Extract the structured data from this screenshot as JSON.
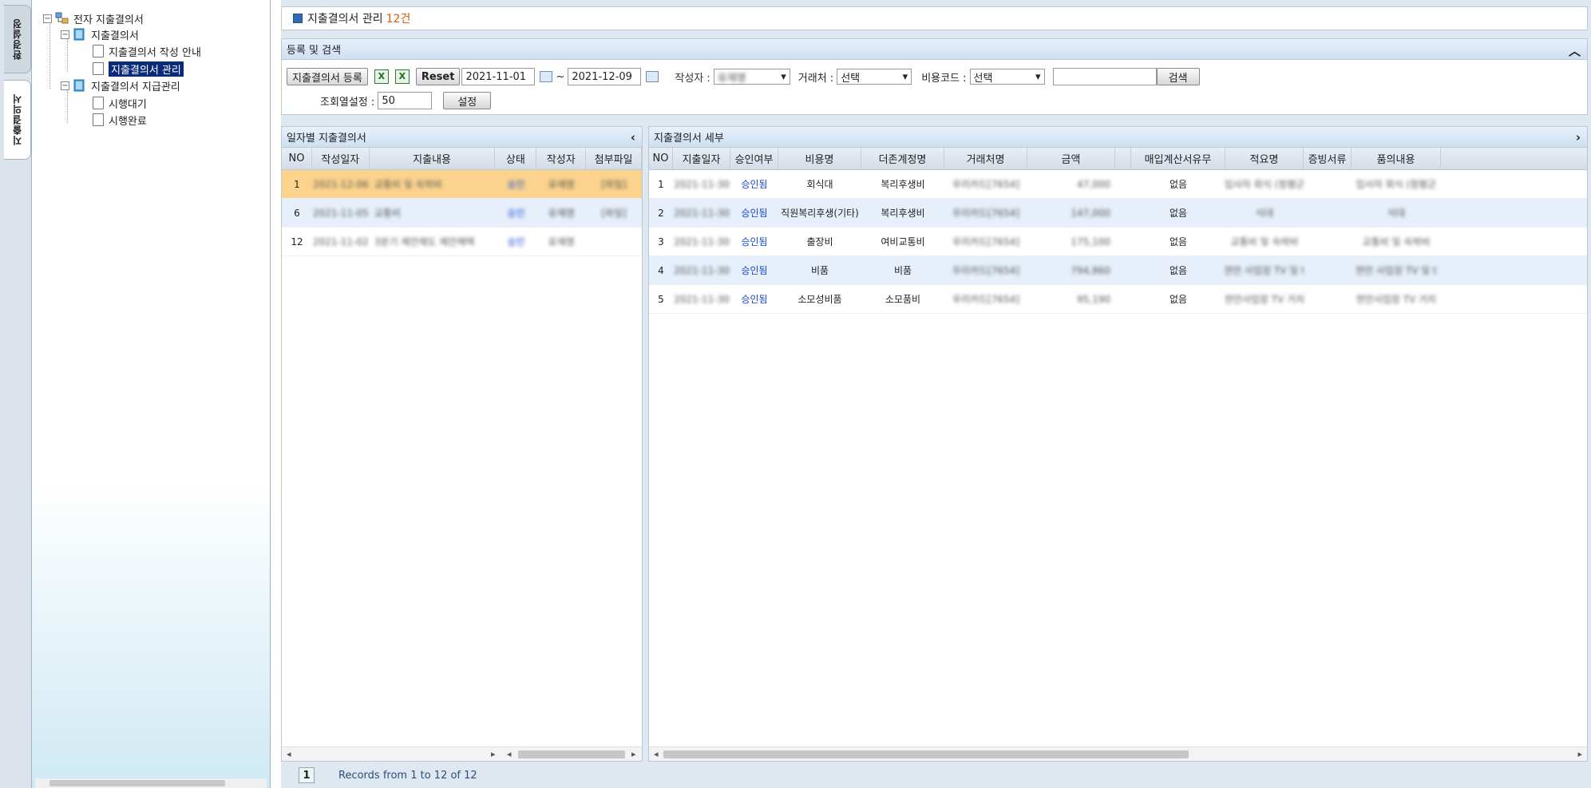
{
  "vtabs": [
    "환경설정",
    "지출결의서"
  ],
  "tree": {
    "root": "전자 지출결의서",
    "group1": "지출결의서",
    "group1_items": [
      "지출결의서 작성 안내",
      "지출결의서 관리"
    ],
    "group2": "지출결의서 지급관리",
    "group2_items": [
      "시행대기",
      "시행완료"
    ]
  },
  "title": {
    "label": "지출결의서 관리",
    "count": "12건"
  },
  "search": {
    "header": "등록 및 검색",
    "register_button": "지출결의서 등록",
    "reset_button": "Reset",
    "date_from": "2021-11-01",
    "date_sep": "~",
    "date_to": "2021-12-09",
    "writer_label": "작성자 :",
    "writer_value": "유재명",
    "vendor_label": "거래처 :",
    "vendor_value": "선택",
    "costcode_label": "비용코드 :",
    "costcode_value": "선택",
    "search_button": "검색",
    "rows_label": "조회열설정 :",
    "rows_value": "50",
    "set_button": "설정"
  },
  "left_grid": {
    "header": "일자별 지출결의서",
    "columns": [
      "NO",
      "작성일자",
      "지출내용",
      "상태",
      "작성자",
      "첨부파일"
    ],
    "rows": [
      [
        "1",
        "2021-12-06",
        "교통비 및 숙박비",
        "승인",
        "유재명",
        "[파일]"
      ],
      [
        "6",
        "2021-11-05",
        "교통비",
        "승인",
        "유재명",
        "[파일]"
      ],
      [
        "12",
        "2021-11-02",
        "3분기 제안제도 제안채택",
        "승인",
        "유재명",
        ""
      ]
    ]
  },
  "right_grid": {
    "header": "지출결의서 세부",
    "columns": [
      "NO",
      "지출일자",
      "승인여부",
      "비용명",
      "더존계정명",
      "거래처명",
      "금액",
      "",
      "매입계산서유무",
      "적요명",
      "증빙서류",
      "품의내용"
    ],
    "rows": [
      [
        "1",
        "2021-11-30",
        "승인됨",
        "회식대",
        "복리후생비",
        "우리카드[7654]",
        "47,000",
        "",
        "없음",
        "입사자 회식 (청평군",
        "",
        "입사자 회식 (청평군"
      ],
      [
        "2",
        "2021-11-30",
        "승인됨",
        "직원복리후생(기타)",
        "복리후생비",
        "우리카드[7654]",
        "147,000",
        "",
        "없음",
        "식대",
        "",
        "식대"
      ],
      [
        "3",
        "2021-11-30",
        "승인됨",
        "출장비",
        "여비교통비",
        "우리카드[7654]",
        "175,100",
        "",
        "없음",
        "교통비 및 숙박비",
        "",
        "교통비 및 숙박비"
      ],
      [
        "4",
        "2021-11-30",
        "승인됨",
        "비품",
        "비품",
        "우리카드[7654]",
        "794,860",
        "",
        "없음",
        "현안 사업장 TV 및 t",
        "",
        "현안 사업장 TV 및 t"
      ],
      [
        "5",
        "2021-11-30",
        "승인됨",
        "소모성비품",
        "소모품비",
        "우리카드[7654]",
        "95,190",
        "",
        "없음",
        "현안사업장 TV 거치",
        "",
        "현안사업장 TV 거치"
      ]
    ]
  },
  "pager": {
    "page": "1",
    "text": "Records from 1 to 12 of 12"
  }
}
